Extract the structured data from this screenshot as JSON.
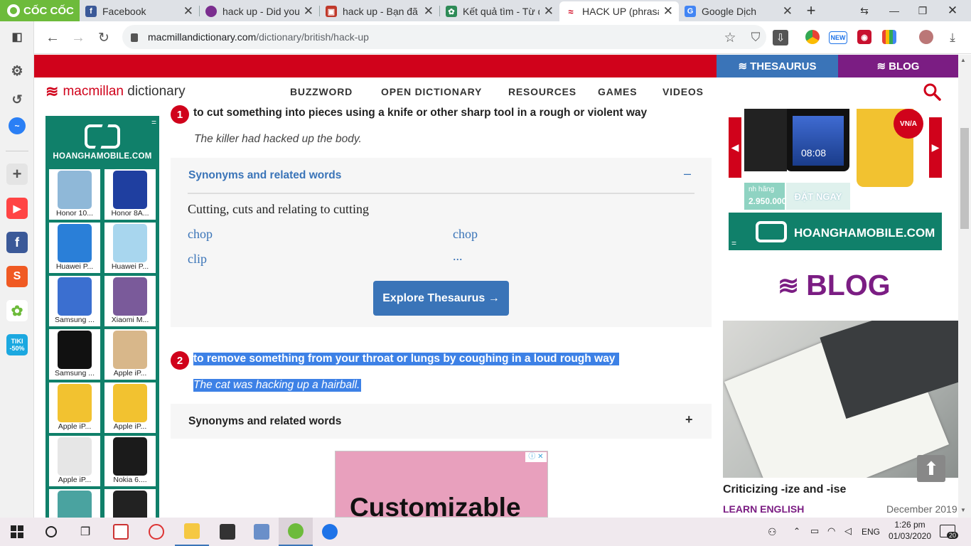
{
  "browser": {
    "brand": "CỐC CỐC",
    "tabs": [
      {
        "title": "Facebook",
        "icon": "facebook-icon",
        "color": "#3b5998"
      },
      {
        "title": "hack up - Did you",
        "icon": "site-icon",
        "color": "#7b2e8f"
      },
      {
        "title": "hack up - Bạn đã c",
        "icon": "shield-site-icon",
        "color": "#c0392b"
      },
      {
        "title": "Kết quả tìm - Từ đ",
        "icon": "leaf-icon",
        "color": "#2e8b57"
      },
      {
        "title": "HACK UP (phrasal",
        "icon": "macmillan-icon",
        "color": "#d0021b"
      },
      {
        "title": "Google Dịch",
        "icon": "google-translate-icon",
        "color": "#4285f4"
      }
    ],
    "url_host": "macmillandictionary.com",
    "url_path": "/dictionary/british/hack-up"
  },
  "site": {
    "thesaurus_label": "THESAURUS",
    "blog_label": "BLOG",
    "logo_left": "macmillan",
    "logo_right": "dictionary",
    "nav": [
      "BUZZWORD",
      "OPEN DICTIONARY",
      "RESOURCES",
      "GAMES",
      "VIDEOS"
    ]
  },
  "left_ad": {
    "brand": "HOANGHAMOBILE.COM",
    "menu_glyph": "=",
    "items": [
      {
        "name": "Honor 10...",
        "color": "#8fb8d8"
      },
      {
        "name": "Honor 8A...",
        "color": "#1f3fa0"
      },
      {
        "name": "Huawei P...",
        "color": "#2a7fd8"
      },
      {
        "name": "Huawei P...",
        "color": "#a8d6ee"
      },
      {
        "name": "Samsung ...",
        "color": "#3b6fd0"
      },
      {
        "name": "Xiaomi M...",
        "color": "#7a5a9a"
      },
      {
        "name": "Samsung ...",
        "color": "#111111"
      },
      {
        "name": "Apple iP...",
        "color": "#d8b78a"
      },
      {
        "name": "Apple iP...",
        "color": "#f2c230"
      },
      {
        "name": "Apple iP...",
        "color": "#f2c230"
      },
      {
        "name": "Apple iP...",
        "color": "#e6e6e6"
      },
      {
        "name": "Nokia 6....",
        "color": "#1b1b1b"
      },
      {
        "name": "",
        "color": "#4aa3a0"
      },
      {
        "name": "",
        "color": "#222222"
      }
    ]
  },
  "entry": {
    "senses": [
      {
        "num": "1",
        "definition": "to cut something into pieces using a knife or other sharp tool in a rough or violent way",
        "example": "The killer had hacked up the body.",
        "synonyms_heading": "Synonyms and related words",
        "synonyms_toggle": "–",
        "group_title": "Cutting, cuts and relating to cutting",
        "words": [
          "chop",
          "chop",
          "clip",
          "..."
        ],
        "explore_label": "Explore Thesaurus →"
      },
      {
        "num": "2",
        "definition": "to remove something from your throat or lungs by coughing in a loud rough way",
        "example": "The cat was hacking up a hairball.",
        "synonyms_heading": "Synonyms and related words",
        "synonyms_toggle": "+"
      }
    ]
  },
  "bottom_ad": {
    "text": "Customizable"
  },
  "right": {
    "ad_price_label": "nh hãng",
    "ad_price": "2.950.000",
    "ad_cta": "ĐẶT NGAY",
    "ad_time": "08:08",
    "ad_badge": "VN/A",
    "ad_brand": "HOANGHAMOBILE.COM",
    "blog_heading": "BLOG",
    "post_title": "Criticizing -ize and -ise",
    "post_category": "LEARN ENGLISH",
    "post_date": "December 2019"
  },
  "taskbar": {
    "lang": "ENG",
    "time": "1:26 pm",
    "date": "01/03/2020",
    "notifications": "20"
  }
}
